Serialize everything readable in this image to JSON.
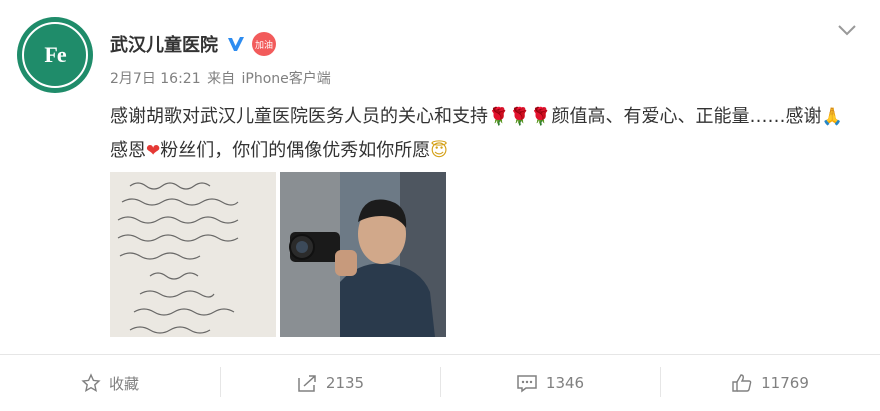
{
  "post": {
    "username": "武汉儿童医院",
    "badge_label": "加油",
    "date": "2月7日 16:21",
    "source_prefix": "来自",
    "source": "iPhone客户端",
    "text_part1": "感谢胡歌对武汉儿童医院医务人员的关心和支持",
    "text_part2": "颜值高、有爱心、正能量……感谢",
    "text_part3": "感恩",
    "text_part4": "粉丝们，你们的偶像优秀如你所愿"
  },
  "images": {
    "left_icon": "handwritten-letter-image",
    "right_icon": "man-with-camera-photo"
  },
  "actions": {
    "favorite_label": "收藏",
    "repost_count": "2135",
    "comment_count": "1346",
    "like_count": "11769"
  },
  "colors": {
    "avatar_green": "#1f8c6a",
    "verify_blue": "#2d8cf0",
    "badge_red": "#f25b5b",
    "text_gray": "#808080"
  }
}
